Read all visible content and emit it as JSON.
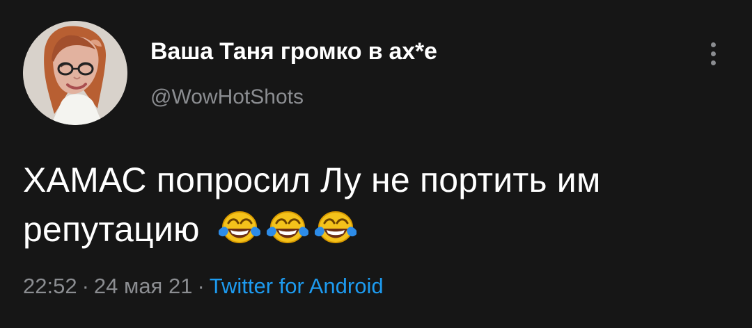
{
  "author": {
    "display_name": "Ваша Таня громко в ах*е",
    "handle": "@WowHotShots"
  },
  "tweet": {
    "line1": "ХАМАС попросил Лу не портить им",
    "line2": "репутацию",
    "emoji_name": "face-with-tears-of-joy-icon",
    "emoji_count": 3
  },
  "meta": {
    "time": "22:52",
    "separator": "·",
    "date": "24 мая 21",
    "source": "Twitter for Android"
  },
  "colors": {
    "background": "#161616",
    "text": "#ffffff",
    "secondary_text": "#8b8d91",
    "link": "#1d9bf0",
    "emoji_yellow": "#f4c21b",
    "tear_blue": "#2d8ce8"
  }
}
